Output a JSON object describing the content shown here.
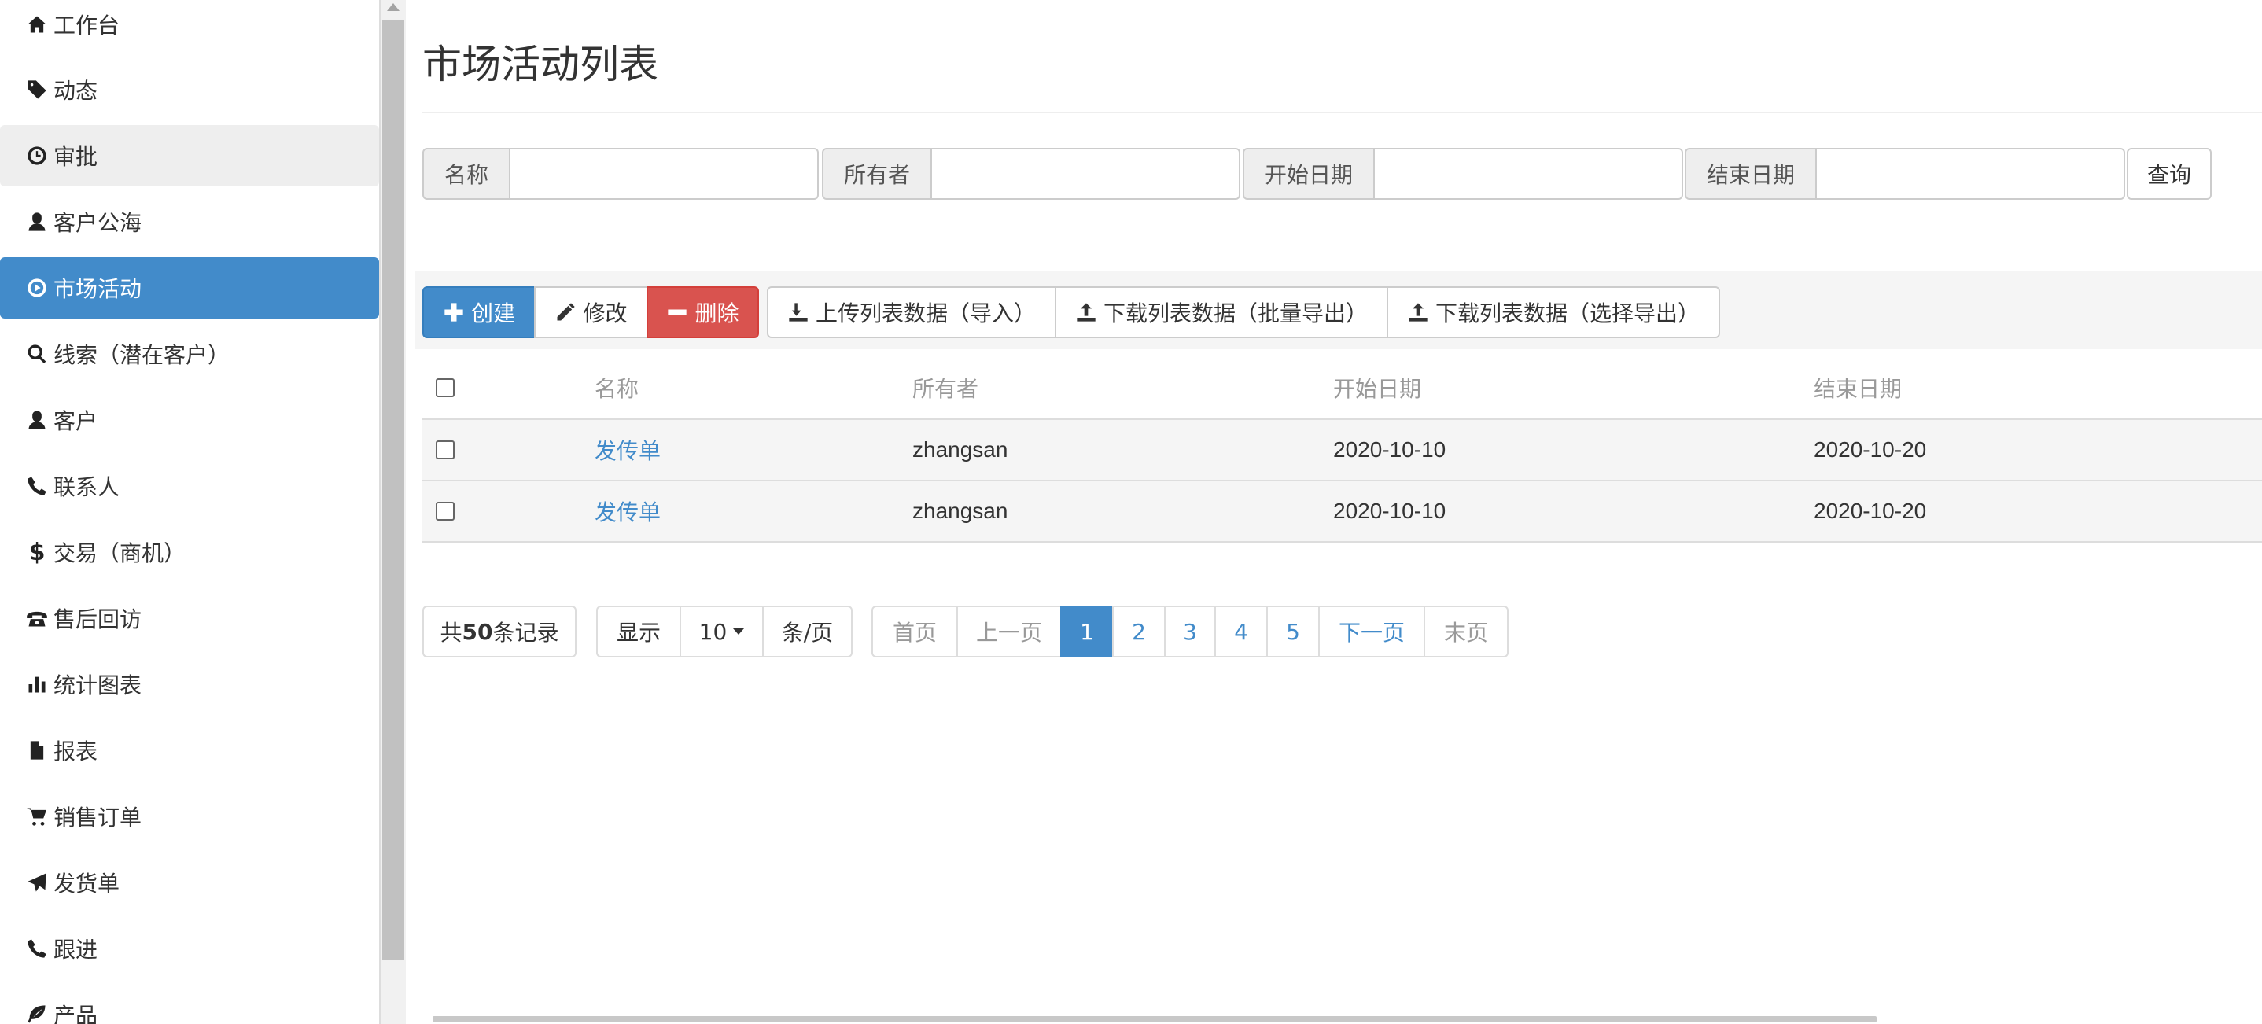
{
  "sidebar": {
    "items": [
      {
        "label": "工作台",
        "icon": "home-icon"
      },
      {
        "label": "动态",
        "icon": "tag-icon"
      },
      {
        "label": "审批",
        "icon": "clock-icon"
      },
      {
        "label": "客户公海",
        "icon": "user-icon"
      },
      {
        "label": "市场活动",
        "icon": "play-circle-icon"
      },
      {
        "label": "线索（潜在客户）",
        "icon": "search-icon"
      },
      {
        "label": "客户",
        "icon": "user-icon"
      },
      {
        "label": "联系人",
        "icon": "phone-icon"
      },
      {
        "label": "交易（商机）",
        "icon": "dollar-icon"
      },
      {
        "label": "售后回访",
        "icon": "phone-alt-icon"
      },
      {
        "label": "统计图表",
        "icon": "bar-chart-icon"
      },
      {
        "label": "报表",
        "icon": "file-icon"
      },
      {
        "label": "销售订单",
        "icon": "shopping-cart-icon"
      },
      {
        "label": "发货单",
        "icon": "send-icon"
      },
      {
        "label": "跟进",
        "icon": "phone-icon"
      },
      {
        "label": "产品",
        "icon": "leaf-icon"
      }
    ],
    "active_index": 4,
    "hover_index": 2
  },
  "page": {
    "title": "市场活动列表"
  },
  "search": {
    "name_label": "名称",
    "name_value": "",
    "owner_label": "所有者",
    "owner_value": "",
    "start_label": "开始日期",
    "start_value": "",
    "end_label": "结束日期",
    "end_value": "",
    "query_button": "查询"
  },
  "toolbar": {
    "create": "创建",
    "edit": "修改",
    "delete": "删除",
    "import": "上传列表数据（导入）",
    "export_all": "下载列表数据（批量导出）",
    "export_selected": "下载列表数据（选择导出）"
  },
  "table": {
    "headers": [
      "名称",
      "所有者",
      "开始日期",
      "结束日期"
    ],
    "rows": [
      {
        "name": "发传单",
        "owner": "zhangsan",
        "start": "2020-10-10",
        "end": "2020-10-20"
      },
      {
        "name": "发传单",
        "owner": "zhangsan",
        "start": "2020-10-10",
        "end": "2020-10-20"
      }
    ]
  },
  "pagination": {
    "total_prefix": "共",
    "total_count": "50",
    "total_suffix": "条记录",
    "show_label": "显示",
    "page_size": "10",
    "per_page_label": "条/页",
    "first": "首页",
    "prev": "上一页",
    "pages": [
      "1",
      "2",
      "3",
      "4",
      "5"
    ],
    "current_page": "1",
    "next": "下一页",
    "last": "末页"
  },
  "colors": {
    "primary": "#428bca",
    "danger": "#d9534f",
    "row_bg": "#f5f5f5"
  }
}
